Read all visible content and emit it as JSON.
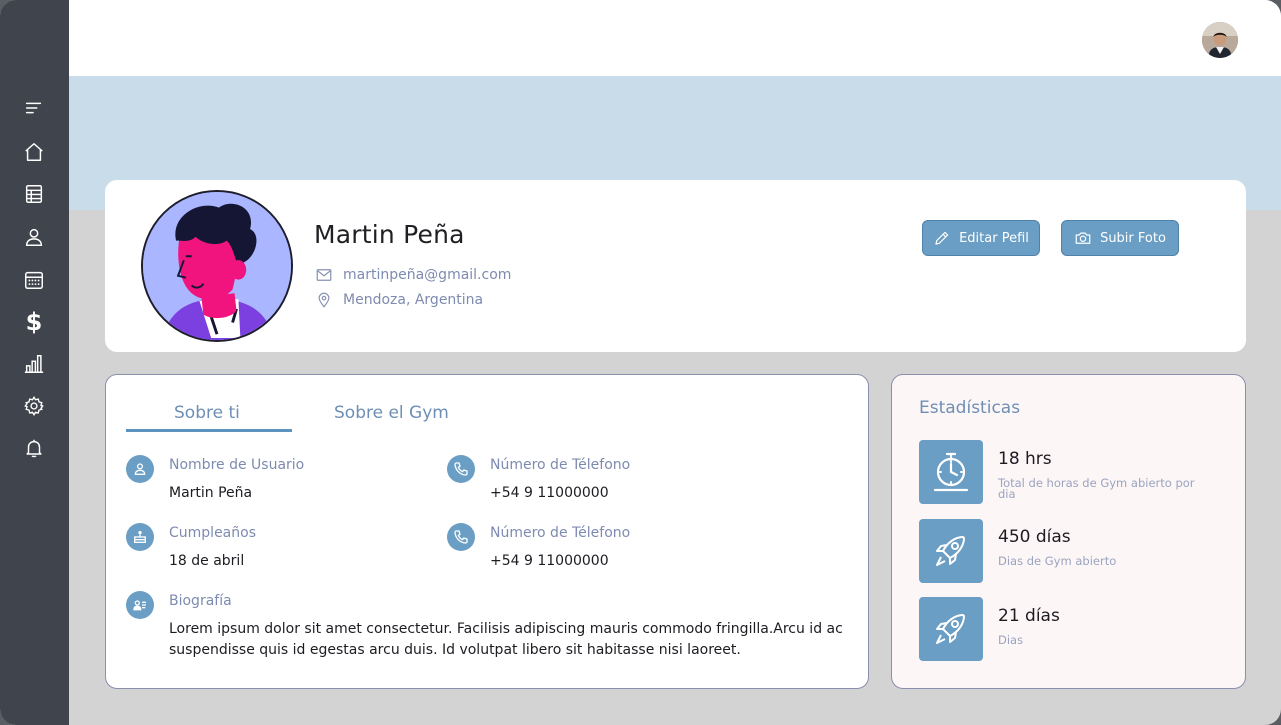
{
  "sidebar": {
    "items": [
      {
        "icon": "menu-icon"
      },
      {
        "icon": "home-icon"
      },
      {
        "icon": "table-icon"
      },
      {
        "icon": "user-icon"
      },
      {
        "icon": "calendar-icon"
      },
      {
        "icon": "dollar-icon",
        "glyph": "$"
      },
      {
        "icon": "bar-chart-icon"
      },
      {
        "icon": "settings-icon"
      },
      {
        "icon": "bell-icon"
      }
    ]
  },
  "profile": {
    "name": "Martin Peña",
    "email": "martinpeña@gmail.com",
    "location": "Mendoza, Argentina",
    "edit_button": "Editar Pefil",
    "upload_button": "Subir Foto"
  },
  "about": {
    "tabs": [
      "Sobre ti",
      "Sobre el Gym"
    ],
    "active_tab": "Sobre ti",
    "fields": {
      "username_label": "Nombre de Usuario",
      "username_value": "Martin Peña",
      "phone1_label": "Número de Télefono",
      "phone1_value": "+54 9 11000000",
      "birthday_label": "Cumpleaños",
      "birthday_value": "18 de abril",
      "phone2_label": "Número de Télefono",
      "phone2_value": "+54 9 11000000",
      "bio_label": "Biografía",
      "bio_value": "Lorem ipsum dolor sit amet consectetur. Facilisis adipiscing mauris commodo fringilla.Arcu id ac suspendisse quis id egestas arcu duis. Id volutpat libero sit habitasse nisi laoreet."
    }
  },
  "stats": {
    "title": "Estadísticas",
    "items": [
      {
        "icon": "stopwatch-icon",
        "value": "18 hrs",
        "desc": "Total de horas de Gym abierto por dia"
      },
      {
        "icon": "rocket-icon",
        "value": "450 días",
        "desc": "Dias de Gym abierto"
      },
      {
        "icon": "rocket-icon",
        "value": "21 días",
        "desc": "Dias"
      }
    ]
  },
  "colors": {
    "sidebar": "#40444c",
    "accent": "#6a9ec4",
    "banner": "#c8dde9",
    "muted_text": "#7e8bb0"
  }
}
